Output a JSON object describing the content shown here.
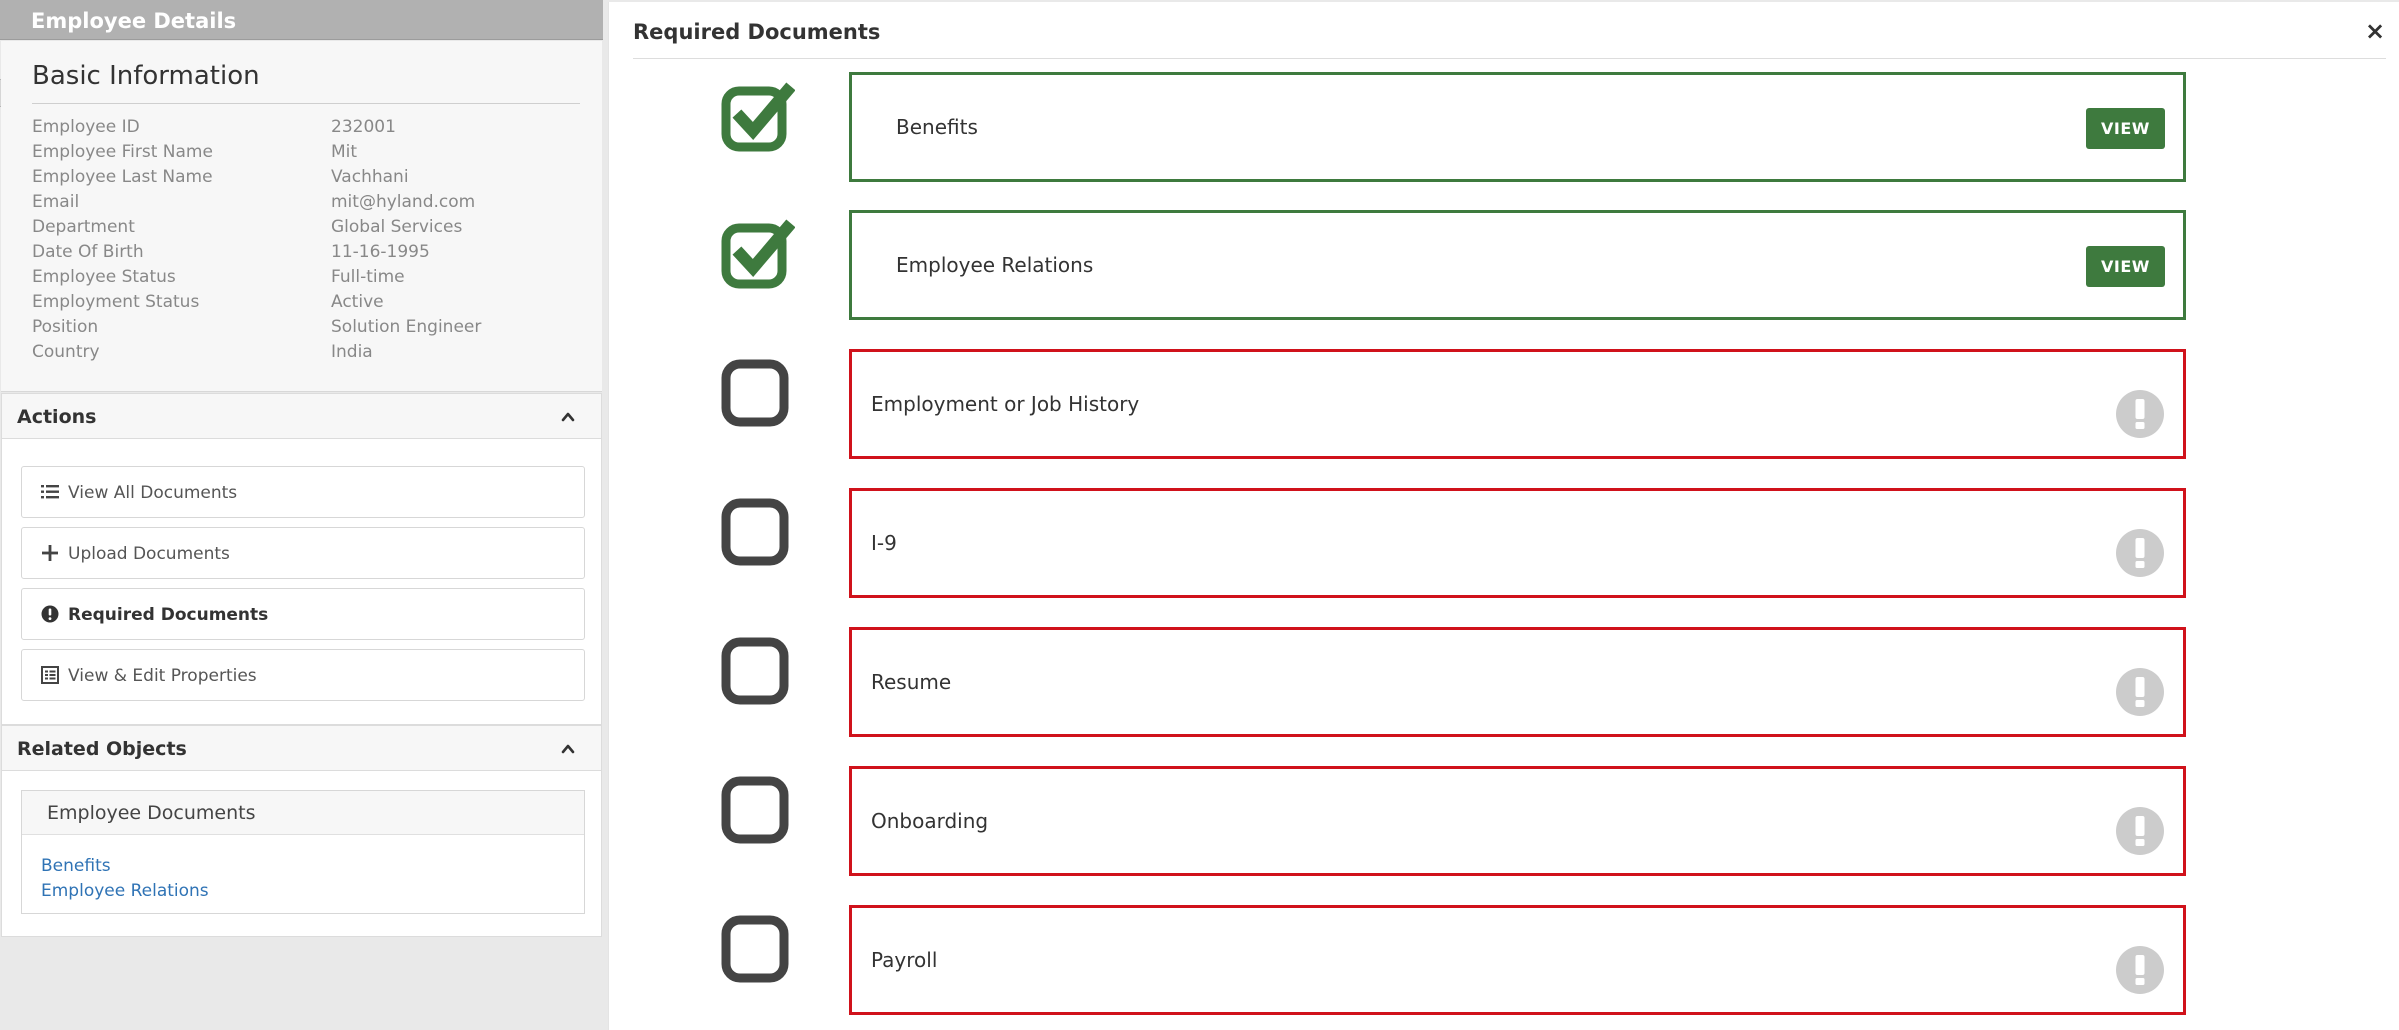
{
  "left": {
    "title": "Employee Details",
    "basic": {
      "heading": "Basic Information",
      "rows": [
        {
          "label": "Employee ID",
          "value": "232001"
        },
        {
          "label": "Employee First Name",
          "value": "Mit"
        },
        {
          "label": "Employee Last Name",
          "value": "Vachhani"
        },
        {
          "label": "Email",
          "value": "mit@hyland.com"
        },
        {
          "label": "Department",
          "value": "Global Services"
        },
        {
          "label": "Date Of Birth",
          "value": "11-16-1995"
        },
        {
          "label": "Employee Status",
          "value": "Full-time"
        },
        {
          "label": "Employment Status",
          "value": "Active"
        },
        {
          "label": "Position",
          "value": "Solution Engineer"
        },
        {
          "label": "Country",
          "value": "India"
        }
      ]
    },
    "actions": {
      "heading": "Actions",
      "items": [
        {
          "label": "View All Documents",
          "icon": "list-icon"
        },
        {
          "label": "Upload Documents",
          "icon": "plus-icon"
        },
        {
          "label": "Required Documents",
          "icon": "exclamation-circle-icon",
          "active": true
        },
        {
          "label": "View & Edit Properties",
          "icon": "table-icon"
        }
      ]
    },
    "related": {
      "heading": "Related Objects",
      "box_title": "Employee Documents",
      "links": [
        "Benefits",
        "Employee Relations"
      ]
    }
  },
  "right": {
    "title": "Required Documents",
    "close_symbol": "×",
    "view_label": "VIEW",
    "documents": [
      {
        "name": "Benefits",
        "status": "complete"
      },
      {
        "name": "Employee Relations",
        "status": "complete"
      },
      {
        "name": "Employment or Job History",
        "status": "missing"
      },
      {
        "name": "I-9",
        "status": "missing"
      },
      {
        "name": "Resume",
        "status": "missing"
      },
      {
        "name": "Onboarding",
        "status": "missing"
      },
      {
        "name": "Payroll",
        "status": "missing"
      }
    ]
  },
  "colors": {
    "complete": "#3e7a3e",
    "missing": "#d0121b",
    "link": "#2f73b5",
    "unchecked": "#444444",
    "warning_icon": "#cccccc"
  }
}
